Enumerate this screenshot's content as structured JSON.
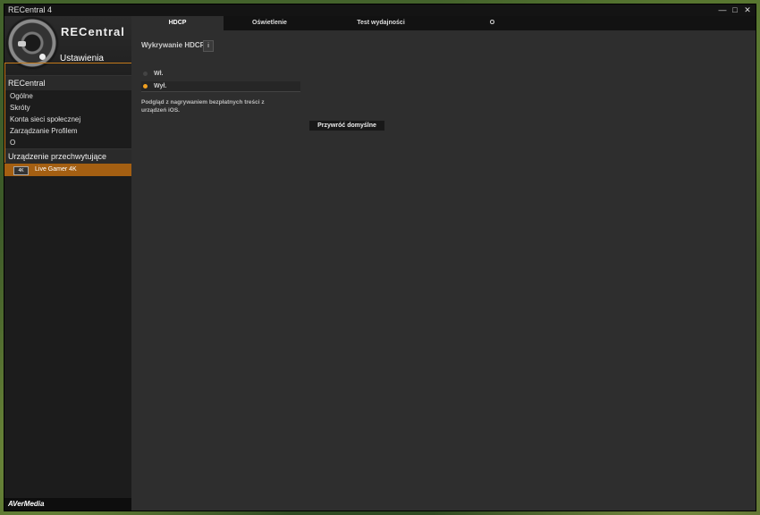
{
  "window": {
    "title": "RECentral 4",
    "controls": [
      "—",
      "□",
      "✕"
    ]
  },
  "sidebar": {
    "brand": "RECentral",
    "subtitle": "Ustawienia",
    "section_recentral": "RECentral",
    "items": [
      "Ogólne",
      "Skróty",
      "Konta sieci społecznej",
      "Zarządzanie Profilem",
      "O"
    ],
    "section_devices": "Urządzenie przechwytujące",
    "device": {
      "icon_label": "4K",
      "name": "Live Gamer 4K"
    },
    "footer": "AVerMedia"
  },
  "tabs": [
    "HDCP",
    "Oświetlenie",
    "Test wydajności",
    "O"
  ],
  "hdcp": {
    "title": "Wykrywanie HDCP",
    "info_icon": "i",
    "options": [
      "Wł.",
      "Wył."
    ],
    "selected_index": 1,
    "note": "Podgląd z nagrywaniem bezpłatnych treści z urządzeń iOS.",
    "reset_label": "Przywróć domyślne"
  },
  "colors": {
    "accent": "#a45f12",
    "radio_on": "#f0a020"
  }
}
